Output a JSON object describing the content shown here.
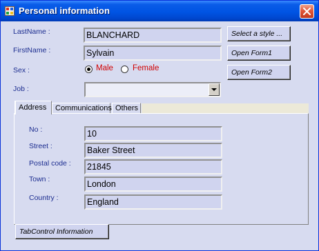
{
  "window": {
    "title": "Personal information"
  },
  "form": {
    "lastname_label": "LastName :",
    "lastname_value": "BLANCHARD",
    "firstname_label": "FirstName :",
    "firstname_value": "Sylvain",
    "sex_label": "Sex :",
    "sex_options": [
      {
        "label": "Male",
        "checked": true
      },
      {
        "label": "Female",
        "checked": false
      }
    ],
    "job_label": "Job :",
    "job_value": ""
  },
  "buttons": {
    "select_style": "Select a style ...",
    "open_form1": "Open Form1",
    "open_form2": "Open Form2",
    "tab_info": "TabControl Information"
  },
  "tabs": [
    {
      "label": "Address",
      "active": true
    },
    {
      "label": "Communications",
      "active": false
    },
    {
      "label": "Others",
      "active": false
    }
  ],
  "address": {
    "no_label": "No :",
    "no_value": "10",
    "street_label": "Street :",
    "street_value": "Baker Street",
    "postal_label": "Postal code :",
    "postal_value": "21845",
    "town_label": "Town :",
    "town_value": "London",
    "country_label": "Country :",
    "country_value": "England"
  },
  "icons": {
    "app": "form-app-icon",
    "close": "close-icon",
    "combo": "chevron-down-icon"
  },
  "colors": {
    "label": "#1b2c8f",
    "radio_text": "#d00000",
    "titlebar": "#0054e3",
    "client": "#d7dbf0"
  }
}
